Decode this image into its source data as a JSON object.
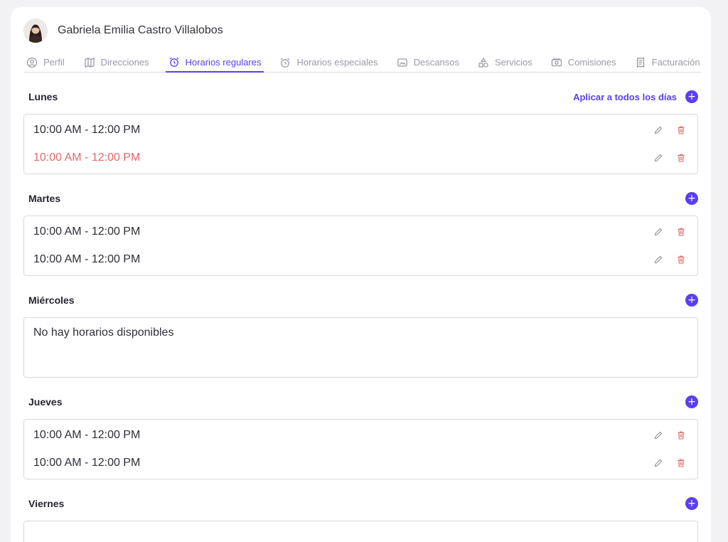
{
  "user": {
    "name": "Gabriela Emilia Castro Villalobos"
  },
  "tabs": [
    {
      "label": "Perfil",
      "icon": "user-circle-icon"
    },
    {
      "label": "Direcciones",
      "icon": "map-icon"
    },
    {
      "label": "Horarios regulares",
      "icon": "alarm-clock-icon",
      "active": true
    },
    {
      "label": "Horarios especiales",
      "icon": "alarm-clock-icon"
    },
    {
      "label": "Descansos",
      "icon": "image-icon"
    },
    {
      "label": "Servicios",
      "icon": "shapes-icon"
    },
    {
      "label": "Comisiones",
      "icon": "money-icon"
    },
    {
      "label": "Facturación",
      "icon": "receipt-icon"
    }
  ],
  "apply_all_label": "Aplicar a todos los días",
  "add_symbol": "+",
  "days": [
    {
      "name": "Lunes",
      "slots": [
        {
          "time": "10:00 AM - 12:00 PM"
        },
        {
          "time": "10:00 AM - 12:00 PM",
          "alert": true
        }
      ]
    },
    {
      "name": "Martes",
      "slots": [
        {
          "time": "10:00 AM - 12:00 PM"
        },
        {
          "time": "10:00 AM - 12:00 PM"
        }
      ]
    },
    {
      "name": "Miércoles",
      "slots": [],
      "empty_text": "No hay horarios disponibles"
    },
    {
      "name": "Jueves",
      "slots": [
        {
          "time": "10:00 AM - 12:00 PM"
        },
        {
          "time": "10:00 AM - 12:00 PM"
        }
      ]
    },
    {
      "name": "Viernes",
      "slots": []
    }
  ],
  "colors": {
    "accent": "#5b3ef0",
    "danger": "#e06a6a",
    "border": "#d9d9e0"
  }
}
